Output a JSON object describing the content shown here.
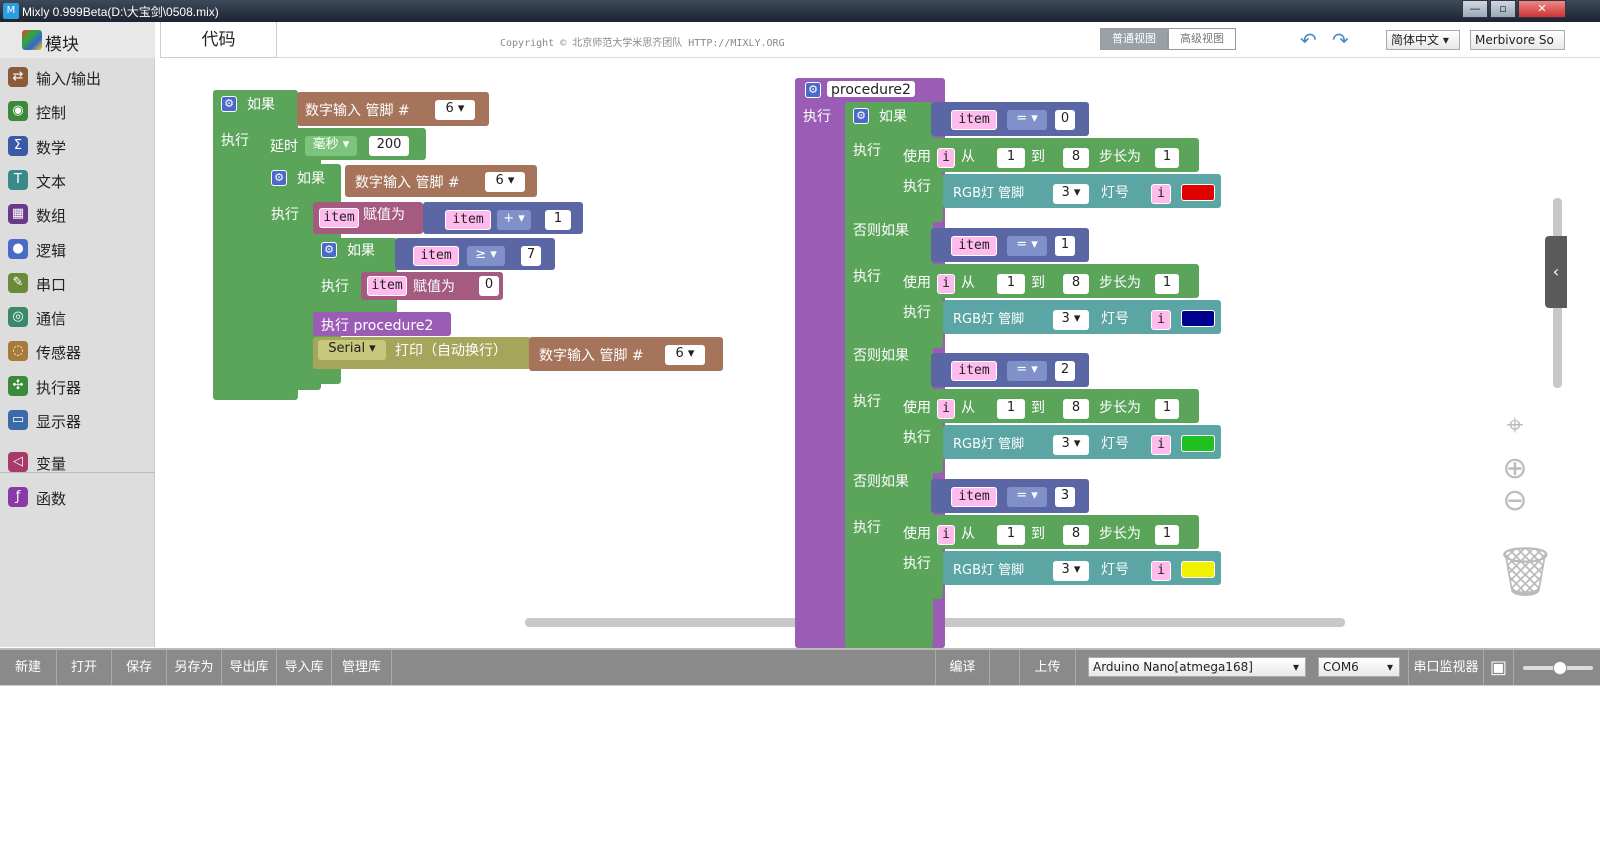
{
  "window": {
    "title": "Mixly 0.999Beta(D:\\大宝剑\\0508.mix)",
    "min": "—",
    "max": "▫",
    "close": "✕"
  },
  "sidebar": {
    "header": "模块",
    "items": [
      {
        "label": "输入/输出",
        "icon": "io-icon",
        "color": "#8a5a3a"
      },
      {
        "label": "控制",
        "icon": "gamepad-icon",
        "color": "#3a8a3a"
      },
      {
        "label": "数学",
        "icon": "sigma-icon",
        "color": "#3a5aa8"
      },
      {
        "label": "文本",
        "icon": "text-t-icon",
        "color": "#3a8a8a"
      },
      {
        "label": "数组",
        "icon": "array-icon",
        "color": "#6a3a8a"
      },
      {
        "label": "逻辑",
        "icon": "lightbulb-icon",
        "color": "#4a6ac8"
      },
      {
        "label": "串口",
        "icon": "pen-icon",
        "color": "#6a8a3a"
      },
      {
        "label": "通信",
        "icon": "satellite-icon",
        "color": "#3a8a6a"
      },
      {
        "label": "传感器",
        "icon": "sensor-icon",
        "color": "#a87a3a"
      },
      {
        "label": "执行器",
        "icon": "actuator-icon",
        "color": "#3a8a3a"
      },
      {
        "label": "显示器",
        "icon": "monitor-icon",
        "color": "#3a6aa8"
      },
      {
        "label": "变量",
        "icon": "variable-icon",
        "color": "#a83a6a"
      },
      {
        "label": "函数",
        "icon": "function-icon",
        "color": "#8a3aa8"
      }
    ]
  },
  "tabs": {
    "code": "代码"
  },
  "header": {
    "copyright": "Copyright © 北京师范大学米思齐团队 HTTP://MIXLY.ORG",
    "view_normal": "普通视图",
    "view_advanced": "高级视图",
    "language": "简体中文",
    "theme": "Merbivore So"
  },
  "blocks": {
    "if": "如果",
    "do": "执行",
    "elseif": "否则如果",
    "digital_read": "数字输入",
    "pin": "管脚",
    "hash": "#",
    "pin6": "6",
    "delay": "延时",
    "ms": "毫秒",
    "delay_val": "200",
    "item": "item",
    "assign": "赋值为",
    "plus": "+",
    "one": "1",
    "gte": "≥",
    "seven": "7",
    "zero": "0",
    "call": "执行 procedure2",
    "serial": "Serial",
    "print": "打印（自动换行）",
    "proc_name": "procedure2",
    "eq": "=",
    "use": "使用",
    "i": "i",
    "from": "从",
    "to": "到",
    "eight": "8",
    "step": "步长为",
    "rgb": "RGB灯",
    "three": "3",
    "led": "灯号",
    "cond_vals": [
      "0",
      "1",
      "2",
      "3"
    ],
    "colors": [
      "#e00000",
      "#000090",
      "#20c020",
      "#f0f000"
    ]
  },
  "toolbar": {
    "new": "新建",
    "open": "打开",
    "save": "保存",
    "saveas": "另存为",
    "export": "导出库",
    "import": "导入库",
    "manage": "管理库",
    "compile": "编译",
    "upload": "上传",
    "board": "Arduino Nano[atmega168]",
    "port": "COM6",
    "monitor": "串口监视器"
  }
}
